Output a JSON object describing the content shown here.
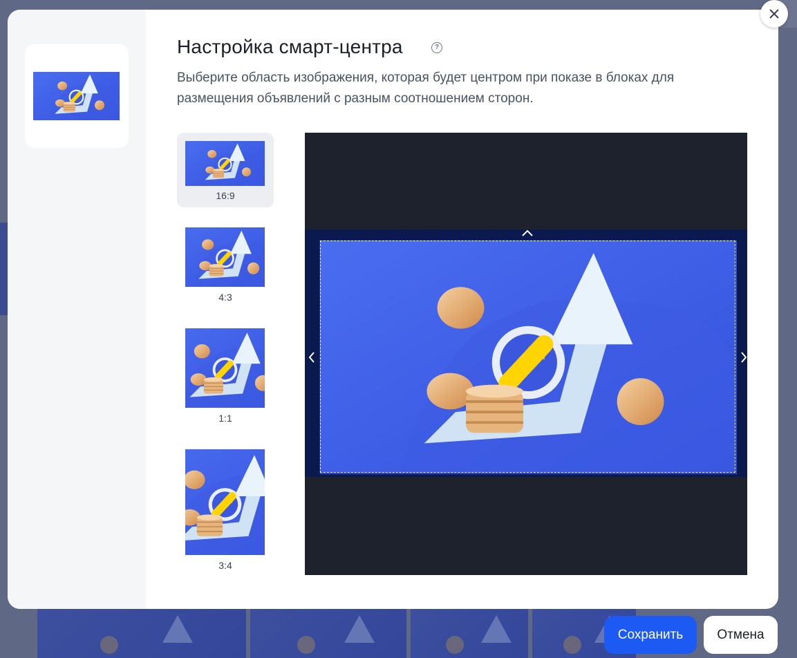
{
  "dialog": {
    "title": "Настройка смарт-центра",
    "subtitle": "Выберите область изображения, которая будет центром при показе в блоках для размещения объявлений с разным соотношением сторон."
  },
  "ratios": [
    {
      "label": "16:9",
      "selected": true
    },
    {
      "label": "4:3",
      "selected": false
    },
    {
      "label": "1:1",
      "selected": false
    },
    {
      "label": "3:4",
      "selected": false
    }
  ],
  "buttons": {
    "save_label": "Сохранить",
    "cancel_label": "Отмена"
  },
  "icons": {
    "help": "question-circle-icon",
    "close": "close-icon",
    "handles": [
      "chevron-up-icon",
      "chevron-left-icon",
      "chevron-right-icon"
    ]
  },
  "colors": {
    "accent": "#1d5af4",
    "image_background": "#3a56e0",
    "editor_background": "#1e222c"
  }
}
